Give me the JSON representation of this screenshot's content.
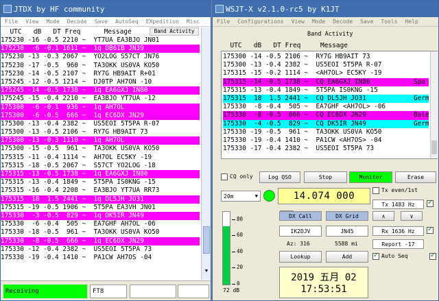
{
  "jtdx": {
    "title": "JTDX   by HF community",
    "menu": [
      "File",
      "View",
      "Mode",
      "Decode",
      "Save",
      "AutoSeq",
      "EXpedition",
      "Misc"
    ],
    "header": "  UTC   dB   DT Freq      Message",
    "band_activity_label": "Band Activity",
    "rows": [
      {
        "t": "175230 -16 -0.5 2210 ~  YT7UA EA3BJO JN01",
        "s": "n"
      },
      {
        "t": "175230  -6 -0.1 1611 ~  1q DB6IB JN39",
        "s": "m"
      },
      {
        "t": "175230 -13 -0.3 2067 ~  YO2LOG S57CT JN76",
        "s": "n"
      },
      {
        "t": "175230 -17 -0.5  960 ~  TA3OKK US0VA KO50",
        "s": "n"
      },
      {
        "t": "175230 -14 -0.5 2107 ~  RY7G HB9AIT R+01",
        "s": "n"
      },
      {
        "t": "175245 -12 -0.5 1214 ~  DJ0TP AH7ON -10",
        "s": "n"
      },
      {
        "t": "175245 -14 -0.5 1738 ~  1q EA6GXJ IN80",
        "s": "m"
      },
      {
        "t": "175245 -15 -0.4 2210 ~  EA3BJO YT7UA -12",
        "s": "n"
      },
      {
        "t": "175300  -6 -0.1  936 ~  1q AH7OL",
        "s": "m"
      },
      {
        "t": "175300  -6 -0.5  666 ~  1q EC6DX JN29",
        "s": "m"
      },
      {
        "t": "175300 -13 -0.4 2382 ~  US5EOI 5T5PA R-07",
        "s": "n"
      },
      {
        "t": "175300 -13 -0.5 2106 ~  RY7G HB9AIT 73",
        "s": "n"
      },
      {
        "t": "175300 -13 -0.3 1110 ~  1q AH7OL",
        "s": "m"
      },
      {
        "t": "175300 -15 -0.5  961 ~  TA3OKK US0VA KO50",
        "s": "n"
      },
      {
        "t": "175315 -11 -0.4 1114 ~  AH7OL EC5KY -19",
        "s": "n"
      },
      {
        "t": "175315 -18 -0.5 2067 ~  S57CT YO2LOG -18",
        "s": "n"
      },
      {
        "t": "175315 -13 -0.5 1738 ~  1q EA6GXJ IN80",
        "s": "m"
      },
      {
        "t": "175315 -13 -0.4 1849 ~  5T5PA IS0KNG -15",
        "s": "n"
      },
      {
        "t": "175315 -16 -0.4 2208 ~  EA3BJO YT7UA RR73",
        "s": "n"
      },
      {
        "t": "175315  18  1.5 2441 ~  1q DL5JH JO31",
        "s": "m"
      },
      {
        "t": "175315 -19 -0.5 1906 ~  5T5PA EA3VH JN01",
        "s": "n"
      },
      {
        "t": "175330  -3 -0.5  829 ~  1q DK5IR JN49",
        "s": "m"
      },
      {
        "t": "175330  -6 -0.4  505 ~  EA7GHF AH7OL -06",
        "s": "n"
      },
      {
        "t": "175330 -18 -0.5  961 ~  TA3OKK US0VA KO50",
        "s": "n"
      },
      {
        "t": "175330  -8 -0.5  666 ~  1q EC6DX JN29",
        "s": "m"
      },
      {
        "t": "175330 -12 -0.4 2382 ~  US5EOI 5T5PA 73",
        "s": "n"
      },
      {
        "t": "175330 -19 -0.4 1410 ~  PA1CW AH7OS -04",
        "s": "n"
      }
    ],
    "status_text": "Receiving",
    "mode_text": "FT8"
  },
  "wsjt": {
    "title": "WSJT-X   v2.1.0-rc5   by K1JT",
    "menu": [
      "File",
      "Configurations",
      "View",
      "Mode",
      "Decode",
      "Save",
      "Tools",
      "Help"
    ],
    "band_activity_label": "Band Activity",
    "header": "  UTC   dB   DT Freq     Message",
    "rows": [
      {
        "t": "175300 -14 -0.5 2106 ~  RY7G HB9AIT 73",
        "s": "n",
        "x": ""
      },
      {
        "t": "175300 -13 -0.4 2382 ~  US5EOI 5T5PA R-07",
        "s": "n",
        "x": ""
      },
      {
        "t": "175315 -15 -0.2 1114 ~  <AH7OL> EC5KY -19",
        "s": "n",
        "x": ""
      },
      {
        "t": "175315 -14 -0.5 1738 ~  CQ EA6GXJ IN80",
        "s": "m",
        "x": "Spa"
      },
      {
        "t": "175315 -13 -0.4 1849 ~  5T5PA IS0KNG -15",
        "s": "n",
        "x": ""
      },
      {
        "t": "175315  18  1.5 2441 ~  CQ DL5JH JO31",
        "s": "c",
        "x": "Germ"
      },
      {
        "t": "175330  -8 -0.4  505 ~  EA7GHF <AH7OL> -06",
        "s": "n",
        "x": ""
      },
      {
        "t": "175330  -8 -0.5  666 ~  CQ EC6DX JN29",
        "s": "m",
        "x": "Bale"
      },
      {
        "t": "175330  -4 -0.5  829 ~  CQ DK5IR JN49",
        "s": "c",
        "x": "Germ"
      },
      {
        "t": "175330 -19 -0.5  961 ~  TA3OKK US0VA KO50",
        "s": "n",
        "x": ""
      },
      {
        "t": "175330 -19 -0.4 1410 ~  PA1CW <AH7OS> -04",
        "s": "n",
        "x": ""
      },
      {
        "t": "175330 -17 -0.4 2382 ~  US5EOI 5T5PA 73",
        "s": "n",
        "x": ""
      }
    ],
    "cq_only": "CQ only",
    "log_qso": "Log QSO",
    "stop": "Stop",
    "monitor": "Monitor",
    "erase": "Erase",
    "band": "20m",
    "frequency": "14.074 000",
    "tx_even": "Tx even/1st",
    "tx_hz": "Tx  1483  Hz",
    "rx_hz": "Rx  1636  Hz",
    "report": "Report -17",
    "auto_seq": "Auto Seq",
    "dx_call_label": "DX Call",
    "dx_grid_label": "DX Grid",
    "dx_call": "IK2DJV",
    "dx_grid": "JN45",
    "az": "Az: 316",
    "dist": "5588 mi",
    "lookup": "Lookup",
    "add": "Add",
    "date": "2019 五月 02",
    "time": "17:53:51",
    "meter_ticks": [
      "80",
      "60",
      "40",
      "20",
      "0"
    ],
    "meter_db": "72 dB",
    "meter_level_db": 72,
    "meter_max_db": 90,
    "colors": {
      "magenta": "#ff00ff",
      "cyan": "#00ffff",
      "monitor_green": "#00ff00",
      "freq_bg": "#ffff99",
      "clock_bg": "#ffffcc",
      "status_green": "#00ff00"
    }
  }
}
